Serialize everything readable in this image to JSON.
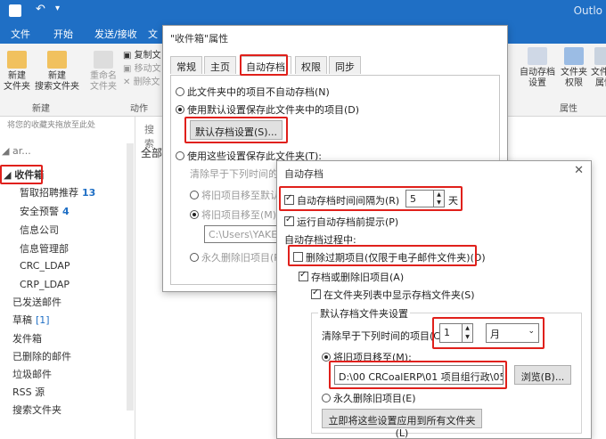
{
  "window": {
    "title_right": "Outlo"
  },
  "ribbon_tabs": [
    "文件",
    "开始",
    "发送/接收",
    "文"
  ],
  "ribbon": {
    "new_folder": [
      "新建",
      "文件夹"
    ],
    "new_search_folder": [
      "新建",
      "搜索文件夹"
    ],
    "rename_folder": [
      "重命名",
      "文件夹"
    ],
    "copy_folder": "复制文",
    "move_folder": "移动文",
    "delete_folder": "删除文",
    "group_new": "新建",
    "group_actions": "动作",
    "autoarchive_settings": [
      "自动存档",
      "设置"
    ],
    "folder_permissions": [
      "文件夹",
      "权限"
    ],
    "folder_properties": [
      "文件夹",
      "属性"
    ],
    "group_properties": "属性"
  },
  "folder_pane": {
    "favorites_hint": "将您的收藏夹拖放至此处",
    "account": "ar...",
    "items": [
      {
        "label": "收件箱",
        "count": ""
      },
      {
        "label": "暂取招聘推荐",
        "count": "13"
      },
      {
        "label": "安全预警",
        "count": "4"
      },
      {
        "label": "信息公司",
        "count": ""
      },
      {
        "label": "信息管理部",
        "count": ""
      },
      {
        "label": "CRC_LDAP",
        "count": ""
      },
      {
        "label": "CRP_LDAP",
        "count": ""
      },
      {
        "label": "已发送邮件",
        "count": ""
      },
      {
        "label": "草稿",
        "count": "[1]"
      },
      {
        "label": "发件箱",
        "count": ""
      },
      {
        "label": "已删除的邮件",
        "count": ""
      },
      {
        "label": "垃圾邮件",
        "count": ""
      },
      {
        "label": "RSS 源",
        "count": ""
      },
      {
        "label": "搜索文件夹",
        "count": ""
      }
    ],
    "search_stub": "搜索",
    "all_stub": "全部"
  },
  "props_dialog": {
    "title": "\"收件箱\"属性",
    "tabs": [
      "常规",
      "主页",
      "自动存档",
      "权限",
      "同步"
    ],
    "opt_no_archive": "此文件夹中的项目不自动存档(N)",
    "opt_default": "使用默认设置保存此文件夹中的项目(D)",
    "default_settings_button": "默认存档设置(S)...",
    "opt_custom": "使用这些设置保存此文件夹(T):",
    "clear_older": "清除早于下列时间的项",
    "move_to_default": "将旧项目移至默认存",
    "move_to": "将旧项目移至(M):",
    "path_stub": "C:\\Users\\YAKEA",
    "perm_delete": "永久删除旧项目(P)"
  },
  "autoarchive_dialog": {
    "title": "自动存档",
    "run_every": "自动存档时间间隔为(R)",
    "days_value": "5",
    "days_unit": "天",
    "prompt_before": "运行自动存档前提示(P)",
    "during_label": "自动存档过程中:",
    "delete_expired": "删除过期项目(仅限于电子邮件文件夹)(D)",
    "archive_or_delete": "存档或删除旧项目(A)",
    "show_in_list": "在文件夹列表中显示存档文件夹(S)",
    "defaults_legend": "默认存档文件夹设置",
    "clean_older": "清除早于下列时间的项目(C):",
    "age_value": "1",
    "age_unit": "月",
    "move_to": "将旧项目移至(M):",
    "path": "D:\\00 CRCoalERP\\01 项目组行政\\05 邮",
    "browse": "浏览(B)...",
    "perm_delete": "永久删除旧项目(E)",
    "apply_all": "立即将这些设置应用到所有文件夹(L)"
  }
}
